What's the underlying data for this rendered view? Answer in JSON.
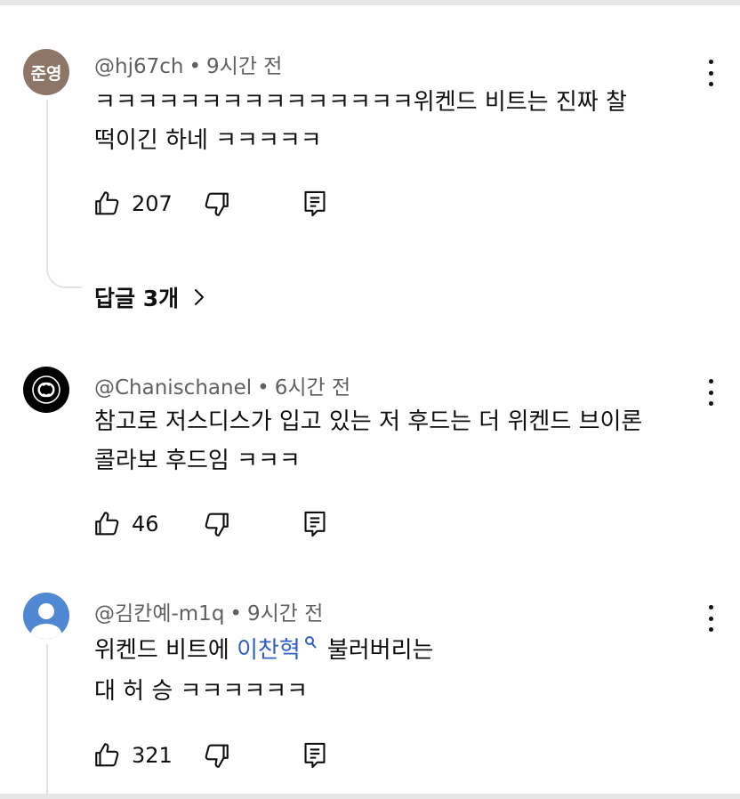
{
  "comments": [
    {
      "avatar_text": "준영",
      "username": "@hj67ch",
      "separator": "•",
      "time": "9시간 전",
      "lines": [
        "ㅋㅋㅋㅋㅋㅋㅋㅋㅋㅋㅋㅋㅋㅋㅋ위켄드 비트는 진짜 찰",
        "떡이긴 하네 ㅋㅋㅋㅋㅋ"
      ],
      "likes": "207",
      "replies_label": "답글 3개"
    },
    {
      "avatar_icon": "chanel-logo-icon",
      "username": "@Chanischanel",
      "separator": "•",
      "time": "6시간 전",
      "lines": [
        "참고로 저스디스가 입고 있는 저 후드는 더 위켄드 브이론",
        "콜라보 후드임 ㅋㅋㅋ"
      ],
      "likes": "46"
    },
    {
      "avatar_icon": "default-user-icon",
      "username": "@김칸예-m1q",
      "separator": "•",
      "time": "9시간 전",
      "line1_before": "위켄드 비트에 ",
      "mention": "이찬혁",
      "line1_after": "불러버리는",
      "line2": "대 허 승 ㅋㅋㅋㅋㅋㅋ",
      "likes": "321"
    }
  ],
  "colors": {
    "meta": "#606060",
    "mention": "#2f5fc8",
    "thread_line": "#e3e3e3"
  },
  "icons": [
    "thumbs-up-icon",
    "thumbs-down-icon",
    "reply-icon",
    "more-vert-icon",
    "chevron-right-icon",
    "search-icon"
  ]
}
